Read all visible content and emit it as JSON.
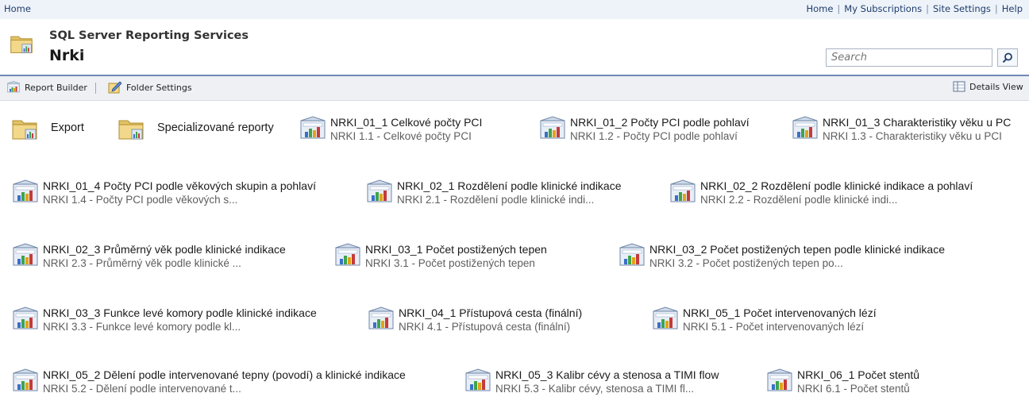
{
  "topbar": {
    "home_left": "Home",
    "links": [
      "Home",
      "My Subscriptions",
      "Site Settings",
      "Help"
    ]
  },
  "header": {
    "app_name": "SQL Server Reporting Services",
    "folder_name": "Nrki",
    "search_placeholder": "Search"
  },
  "toolbar": {
    "report_builder": "Report Builder",
    "folder_settings": "Folder Settings",
    "details_view": "Details View"
  },
  "folders": [
    {
      "label": "Export"
    },
    {
      "label": "Specializované reporty"
    }
  ],
  "reports": [
    {
      "title": "NRKI_01_1 Celkové počty PCI",
      "desc": "NRKI 1.1 - Celkové počty PCI"
    },
    {
      "title": "NRKI_01_2 Počty PCI podle pohlaví",
      "desc": "NRKI 1.2 - Počty PCI podle pohlaví"
    },
    {
      "title": "NRKI_01_3 Charakteristiky věku u PC",
      "desc": "NRKI 1.3 - Charakteristiky věku u PCI"
    },
    {
      "title": "NRKI_01_4 Počty PCI podle věkových skupin a pohlaví",
      "desc": "NRKI 1.4 - Počty PCI podle věkových s..."
    },
    {
      "title": "NRKI_02_1 Rozdělení podle klinické indikace",
      "desc": "NRKI 2.1 - Rozdělení podle klinické indi..."
    },
    {
      "title": "NRKI_02_2 Rozdělení podle klinické indikace a pohlaví",
      "desc": "NRKI 2.2 - Rozdělení podle klinické indi..."
    },
    {
      "title": "NRKI_02_3 Průměrný věk podle klinické indikace",
      "desc": "NRKI 2.3 - Průměrný věk podle klinické ..."
    },
    {
      "title": "NRKI_03_1 Počet postižených tepen",
      "desc": "NRKI 3.1 - Počet postižených tepen"
    },
    {
      "title": "NRKI_03_2 Počet postižených tepen podle klinické indikace",
      "desc": "NRKI 3.2 - Počet postižených tepen po..."
    },
    {
      "title": "NRKI_03_3 Funkce levé komory podle klinické indikace",
      "desc": "NRKI 3.3 - Funkce levé komory podle kl..."
    },
    {
      "title": "NRKI_04_1 Přístupová cesta (finální)",
      "desc": "NRKI 4.1 - Přístupová cesta (finální)"
    },
    {
      "title": "NRKI_05_1 Počet intervenovaných lézí",
      "desc": "NRKI 5.1 - Počet intervenovaných lézí"
    },
    {
      "title": "NRKI_05_2 Dělení podle intervenované tepny (povodí) a klinické indikace",
      "desc": "NRKI 5.2 - Dělení podle intervenované t..."
    },
    {
      "title": "NRKI_05_3 Kalibr cévy a stenosa a TIMI flow",
      "desc": "NRKI 5.3 - Kalibr cévy, stenosa a TIMI fl..."
    },
    {
      "title": "NRKI_06_1 Počet stentů",
      "desc": "NRKI 6.1 - Počet stentů"
    }
  ]
}
